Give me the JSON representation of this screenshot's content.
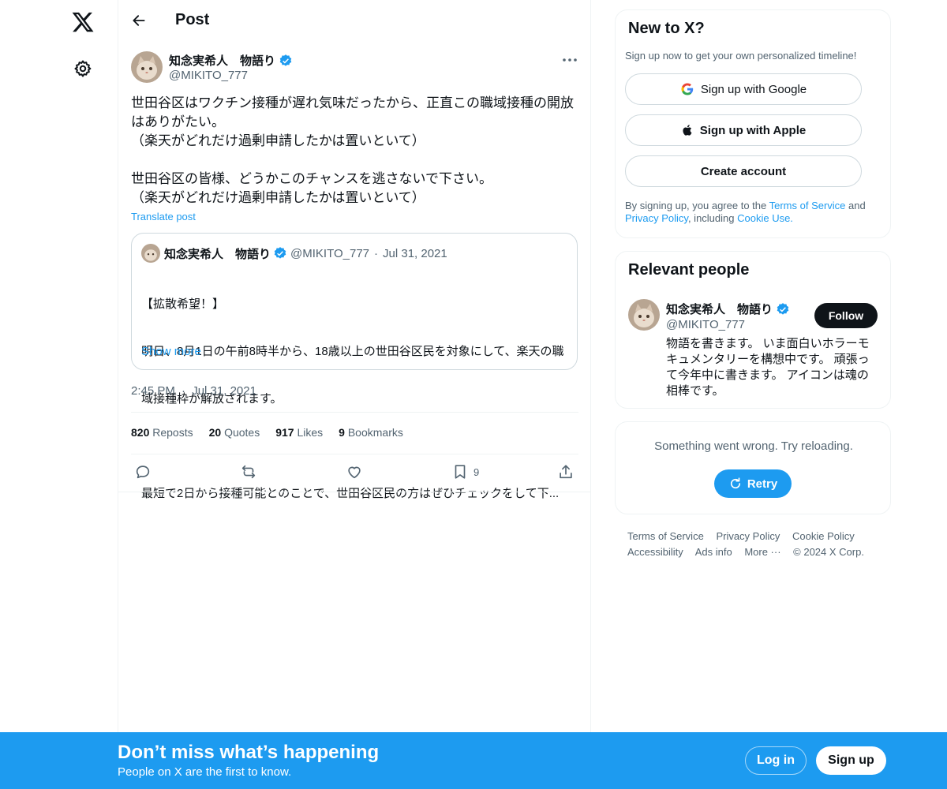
{
  "header": {
    "title": "Post"
  },
  "post": {
    "author_name": "知念実希人　物語り",
    "author_handle": "@MIKITO_777",
    "text": "世田谷区はワクチン接種が遅れ気味だったから、正直この職域接種の開放\nはありがたい。\n（楽天がどれだけ過剰申請したかは置いといて）\n\n世田谷区の皆様、どうかこのチャンスを逃さないで下さい。\n（楽天がどれだけ過剰申請したかは置いといて）",
    "translate_label": "Translate post",
    "time": "2:45 PM",
    "date": "Jul 31, 2021",
    "date_sep": "·"
  },
  "quote": {
    "author_name": "知念実希人　物語り",
    "author_handle": "@MIKITO_777",
    "sep": "·",
    "date": "Jul 31, 2021",
    "line1": "【拡散希望！】",
    "line2": "明日、8月1日の午前8時半から、18歳以上の世田谷区民を対象にして、楽天の職",
    "line3": "域接種枠が解放されます。",
    "line4": "最短で2日から接種可能とのことで、世田谷区民の方はぜひチェックをして下...",
    "show_more": "Show more"
  },
  "stats": {
    "reposts_count": "820",
    "reposts_label": "Reposts",
    "quotes_count": "20",
    "quotes_label": "Quotes",
    "likes_count": "917",
    "likes_label": "Likes",
    "bookmarks_count": "9",
    "bookmarks_label": "Bookmarks"
  },
  "actions": {
    "bookmark_count": "9"
  },
  "signup_card": {
    "title": "New to X?",
    "subtitle": "Sign up now to get your own personalized timeline!",
    "google_label": "Sign up with Google",
    "apple_label": "Sign up with Apple",
    "create_label": "Create account",
    "legal_prefix": "By signing up, you agree to the ",
    "terms": "Terms of Service",
    "and": " and",
    "privacy": "Privacy Policy",
    "including": ", including ",
    "cookie": "Cookie Use."
  },
  "people_card": {
    "title": "Relevant people",
    "name": "知念実希人　物語り",
    "handle": "@MIKITO_777",
    "follow_label": "Follow",
    "bio": "物語を書きます。 いま面白いホラーモキュメンタリーを構想中です。 頑張って今年中に書きます。 アイコンは魂の相棒です。"
  },
  "error_card": {
    "message": "Something went wrong. Try reloading.",
    "retry_label": "Retry"
  },
  "footer": {
    "terms": "Terms of Service",
    "privacy": "Privacy Policy",
    "cookie": "Cookie Policy",
    "accessibility": "Accessibility",
    "ads": "Ads info",
    "more": "More ···",
    "copyright": "© 2024 X Corp."
  },
  "banner": {
    "title": "Don’t miss what’s happening",
    "subtitle": "People on X are the first to know.",
    "login_label": "Log in",
    "signup_label": "Sign up"
  },
  "colors": {
    "accent": "#1d9bf0",
    "text": "#0f1419",
    "muted": "#536471",
    "border": "#eff3f4"
  },
  "icons": [
    "x-logo-icon",
    "settings-gear-icon",
    "back-arrow-icon",
    "verified-badge-icon",
    "more-dots-icon",
    "reply-icon",
    "repost-icon",
    "like-heart-icon",
    "bookmark-icon",
    "share-icon",
    "google-icon",
    "apple-icon",
    "retry-icon"
  ]
}
